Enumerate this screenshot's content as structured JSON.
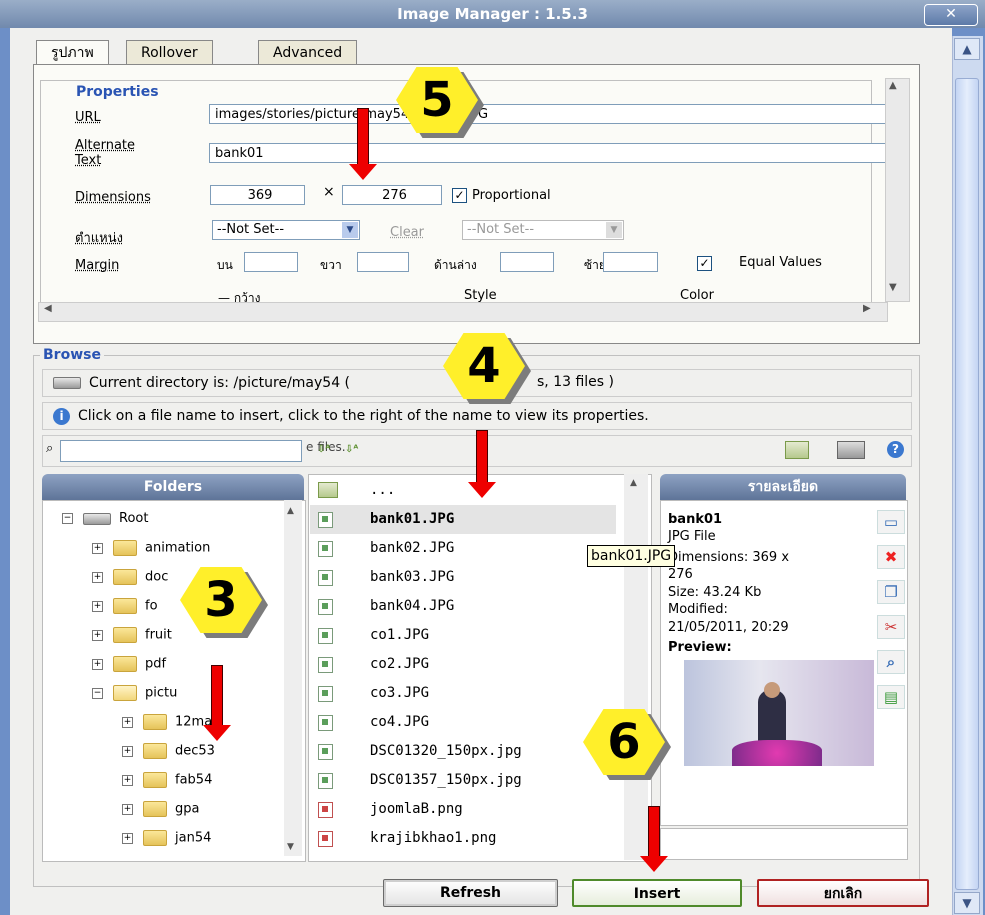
{
  "window": {
    "title": "Image Manager : 1.5.3",
    "close_glyph": "✕"
  },
  "tabs": [
    {
      "label": "รูปภาพ",
      "active": true
    },
    {
      "label": "Rollover",
      "active": false
    },
    {
      "label": "Advanced",
      "active": false
    }
  ],
  "properties": {
    "legend": "Properties",
    "url_label": "URL",
    "url_value": "images/stories/picture/may54/bank01.JPG",
    "alt_label": "Alternate Text",
    "alt_value": "bank01",
    "dimensions_label": "Dimensions",
    "width": "369",
    "times": "×",
    "height": "276",
    "proportional_label": "Proportional",
    "proportional_checked": true,
    "position_label": "ตำแหน่ง",
    "align_value": "--Not Set--",
    "clear_label": "Clear",
    "clear_value": "--Not Set--",
    "margin_label": "Margin",
    "margin_top": "บน",
    "margin_right": "ขวา",
    "margin_bottom": "ด้านล่าง",
    "margin_left": "ซ้าย",
    "equal_values_label": "Equal Values",
    "equal_checked": true,
    "border_width": "กว้าง",
    "border_style": "Style",
    "border_color": "Color"
  },
  "browse": {
    "legend": "Browse",
    "current_dir": "Current directory is: /picture/may54 (",
    "current_dir_tail": "s, 13 files )",
    "hint": "Click on a file name to insert, click to the right of the name to view its properties.",
    "search_tail": "e files.",
    "sort_icons": [
      "sort-az-icon",
      "sort-za-icon"
    ]
  },
  "folders": {
    "header": "Folders",
    "root": "Root",
    "items": [
      {
        "label": "animation",
        "level": 1
      },
      {
        "label": "doc",
        "level": 1
      },
      {
        "label": "fo",
        "level": 1
      },
      {
        "label": "fruit",
        "level": 1
      },
      {
        "label": "pdf",
        "level": 1
      },
      {
        "label": "pictu",
        "level": 1,
        "open": true
      },
      {
        "label": "12may",
        "level": 2
      },
      {
        "label": "dec53",
        "level": 2
      },
      {
        "label": "fab54",
        "level": 2
      },
      {
        "label": "gpa",
        "level": 2
      },
      {
        "label": "jan54",
        "level": 2
      }
    ]
  },
  "files": {
    "up": "...",
    "items": [
      {
        "name": "bank01.JPG",
        "type": "jpg",
        "selected": true
      },
      {
        "name": "bank02.JPG",
        "type": "jpg"
      },
      {
        "name": "bank03.JPG",
        "type": "jpg"
      },
      {
        "name": "bank04.JPG",
        "type": "jpg"
      },
      {
        "name": "co1.JPG",
        "type": "jpg"
      },
      {
        "name": "co2.JPG",
        "type": "jpg"
      },
      {
        "name": "co3.JPG",
        "type": "jpg"
      },
      {
        "name": "co4.JPG",
        "type": "jpg"
      },
      {
        "name": "DSC01320_150px.jpg",
        "type": "jpg"
      },
      {
        "name": "DSC01357_150px.jpg",
        "type": "jpg"
      },
      {
        "name": "joomlaB.png",
        "type": "png"
      },
      {
        "name": "krajibkhao1.png",
        "type": "png"
      }
    ],
    "tooltip": "bank01.JPG"
  },
  "details": {
    "header": "รายละเอียด",
    "name": "bank01",
    "type": "JPG File",
    "dimensions": "Dimensions: 369 x",
    "dimensions_tail": "276",
    "size": "Size: 43.24 Kb",
    "modified_label": "Modified:",
    "modified_value": "21/05/2011, 20:29",
    "preview_label": "Preview:"
  },
  "buttons": {
    "refresh": "Refresh",
    "insert": "Insert",
    "cancel": "ยกเลิก"
  },
  "badges": [
    "5",
    "4",
    "3",
    "6"
  ],
  "colors": {
    "accent": "#2a54b3",
    "arrow": "#e00000",
    "badge": "#ffef2a"
  }
}
